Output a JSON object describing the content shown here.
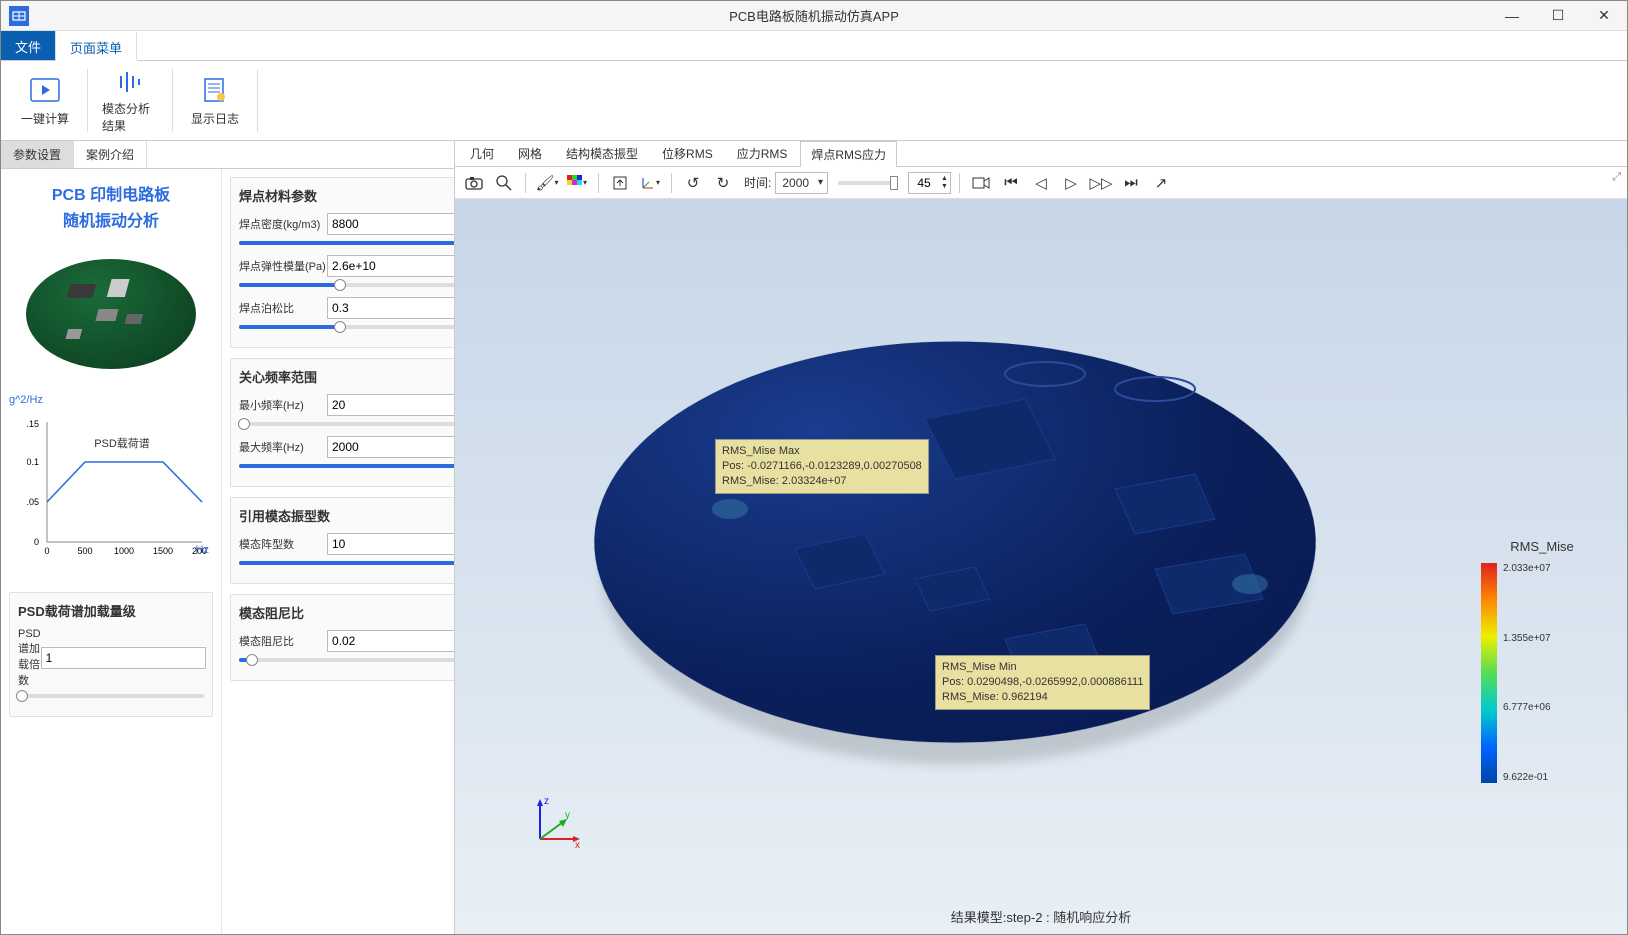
{
  "app": {
    "title": "PCB电路板随机振动仿真APP"
  },
  "menu": {
    "file": "文件",
    "page": "页面菜单"
  },
  "ribbon": {
    "compute": "一键计算",
    "modal_result": "模态分析结果",
    "show_log": "显示日志"
  },
  "left_tabs": {
    "params": "参数设置",
    "case": "案例介绍"
  },
  "pcb_header": {
    "l1": "PCB 印制电路板",
    "l2": "随机振动分析"
  },
  "psd_chart": {
    "ylabel": "g^2/Hz",
    "xlabel": "Hz",
    "legend": "PSD载荷谱",
    "yticks": [
      "0",
      "0.05",
      "0.1",
      "0.15"
    ],
    "xticks": [
      "0",
      "500",
      "1000",
      "1500",
      "2000"
    ]
  },
  "groups": {
    "psd_load": {
      "title": "PSD载荷谱加载量级",
      "mult_label": "PSD谱加载倍数",
      "mult_value": "1"
    },
    "solder": {
      "title": "焊点材料参数",
      "density_label": "焊点密度(kg/m3)",
      "density_value": "8800",
      "modulus_label": "焊点弹性模量(Pa)",
      "modulus_value": "2.6e+10",
      "poisson_label": "焊点泊松比",
      "poisson_value": "0.3"
    },
    "freq": {
      "title": "关心频率范围",
      "min_label": "最小频率(Hz)",
      "min_value": "20",
      "max_label": "最大频率(Hz)",
      "max_value": "2000"
    },
    "modes": {
      "title": "引用模态振型数",
      "count_label": "模态阵型数",
      "count_value": "10"
    },
    "damp": {
      "title": "模态阻尼比",
      "ratio_label": "模态阻尼比",
      "ratio_value": "0.02"
    }
  },
  "view_tabs": {
    "geom": "几何",
    "mesh": "网格",
    "modal_shape": "结构模态振型",
    "disp_rms": "位移RMS",
    "stress_rms": "应力RMS",
    "solder_rms": "焊点RMS应力"
  },
  "view_toolbar": {
    "time_label": "时间:",
    "time_value": "2000",
    "frame_value": "45"
  },
  "viewport": {
    "annot_max": {
      "l1": "RMS_Mise Max",
      "l2": "Pos: -0.0271166,-0.0123289,0.00270508",
      "l3": "RMS_Mise: 2.03324e+07"
    },
    "annot_min": {
      "l1": "RMS_Mise Min",
      "l2": "Pos: 0.0290498,-0.0265992,0.000886111",
      "l3": "RMS_Mise: 0.962194"
    },
    "axes": {
      "x": "x",
      "y": "y",
      "z": "z"
    },
    "caption": "结果模型:step-2 : 随机响应分析"
  },
  "legend": {
    "title": "RMS_Mise",
    "ticks": [
      "2.033e+07",
      "1.355e+07",
      "6.777e+06",
      "9.622e-01"
    ]
  },
  "chart_data": {
    "type": "line",
    "title": "PSD载荷谱",
    "xlabel": "Hz",
    "ylabel": "g^2/Hz",
    "xlim": [
      0,
      2000
    ],
    "ylim": [
      0,
      0.15
    ],
    "x": [
      0,
      500,
      1500,
      2000
    ],
    "y": [
      0.05,
      0.1,
      0.1,
      0.05
    ]
  }
}
